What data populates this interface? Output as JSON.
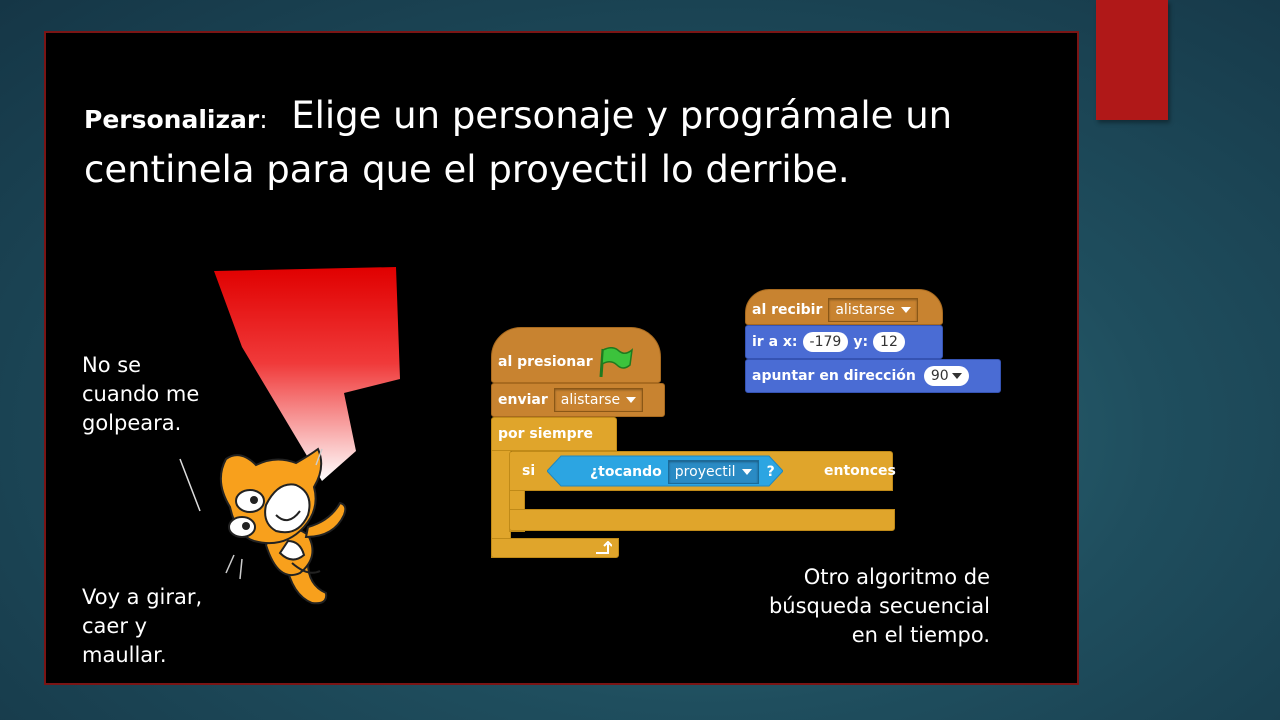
{
  "title": {
    "lead": "Personalizar",
    "colon": ":",
    "text": "Elige un personaje y prográmale un centinela para que el proyectil lo derribe."
  },
  "notes": {
    "cat_thought": "No se\ncuando me\ngolpeara.",
    "cat_plan": "Voy a girar,\ncaer y\nmaullar.",
    "algorithm": "Otro algoritmo de\nbúsqueda secuencial\nen el tiempo."
  },
  "scripts": {
    "receiver": {
      "hat_label": "al recibir",
      "hat_message": "alistarse",
      "goto_label": "ir a x:",
      "goto_x": "-179",
      "goto_y_label": "y:",
      "goto_y": "12",
      "point_label": "apuntar en dirección",
      "point_value": "90"
    },
    "flag": {
      "hat_label": "al presionar",
      "broadcast_label": "enviar",
      "broadcast_message": "alistarse",
      "forever_label": "por siempre",
      "if_label": "si",
      "touching_label": "¿tocando",
      "touching_target": "proyectil",
      "question_mark": "?",
      "then_label": "entonces"
    }
  },
  "colors": {
    "background": "#1f4e5e",
    "slide": "#000000",
    "accent": "#b01818",
    "events": "#c88330",
    "control": "#e0a52b",
    "motion": "#4a6cd4",
    "sensing": "#2ca5e2"
  }
}
